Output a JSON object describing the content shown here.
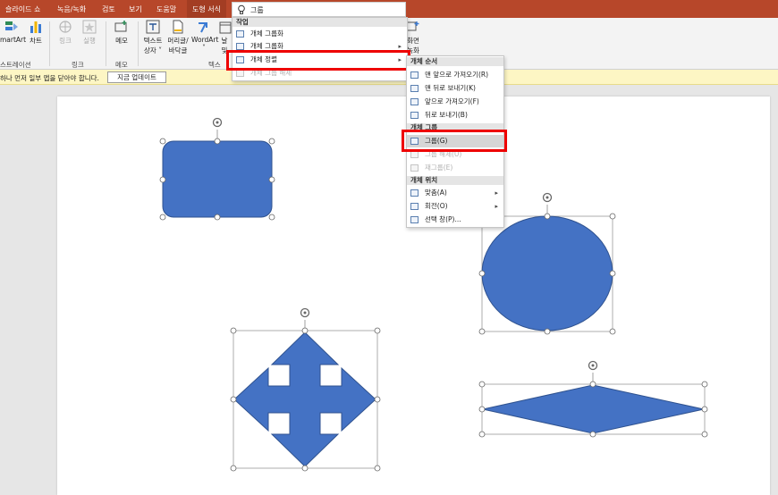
{
  "tabs": [
    {
      "label": "슬라이드 쇼",
      "name": "tab-slideshow"
    },
    {
      "label": "녹음/녹화",
      "name": "tab-record"
    },
    {
      "label": "검토",
      "name": "tab-review"
    },
    {
      "label": "보기",
      "name": "tab-view"
    },
    {
      "label": "도움말",
      "name": "tab-help"
    },
    {
      "label": "도형 서식",
      "name": "tab-shape-format"
    }
  ],
  "search": {
    "value": "그룹"
  },
  "ribbon": {
    "smartart": "martArt",
    "chart": "차트",
    "link": "링크",
    "action": "실행",
    "comment": "메모",
    "textbox": "텍스트\n상자",
    "textbox_l1": "텍스트",
    "textbox_l2": "상자 ˅",
    "header_l1": "머리글/",
    "header_l2": "바닥글",
    "wordart_l1": "WordArt",
    "wordart_l2": "˅",
    "date": "날",
    "date_l2": "및",
    "screen_l1": "화면",
    "screen_l2": "녹화",
    "g_illustration": "스트레이션",
    "g_link": "링크",
    "g_comment": "메모",
    "g_text": "텍스"
  },
  "infobar": {
    "message": "하나 먼저 일부 앱을 닫아야 합니다.",
    "button": "지금 업데이트"
  },
  "search_menu": {
    "header": "작업",
    "items": [
      {
        "label": "개체 그룹화",
        "dim": false,
        "arrow": false
      },
      {
        "label": "개체 그룹화",
        "dim": false,
        "arrow": true
      },
      {
        "label": "개체 정렬",
        "dim": false,
        "arrow": true
      },
      {
        "label": "개체 그룹 해제",
        "dim": true,
        "arrow": false
      }
    ]
  },
  "arrange_menu": {
    "order_header": "개체 순서",
    "order_items": [
      "맨 앞으로 가져오기(R)",
      "맨 뒤로 보내기(K)",
      "앞으로 가져오기(F)",
      "뒤로 보내기(B)"
    ],
    "group_header": "개체 그룹",
    "group_items": [
      {
        "label": "그룹(G)",
        "dim": false
      },
      {
        "label": "그룹 해제(U)",
        "dim": true
      },
      {
        "label": "재그룹(E)",
        "dim": true
      }
    ],
    "position_header": "개체 위치",
    "position_items": [
      {
        "label": "맞춤(A)",
        "arrow": true
      },
      {
        "label": "회전(O)",
        "arrow": true
      },
      {
        "label": "선택 창(P)...",
        "arrow": false
      }
    ]
  },
  "colors": {
    "accent": "#b7472a",
    "shape_fill": "#4472c4",
    "shape_stroke": "#2f528f",
    "highlight": "#ee0000"
  }
}
